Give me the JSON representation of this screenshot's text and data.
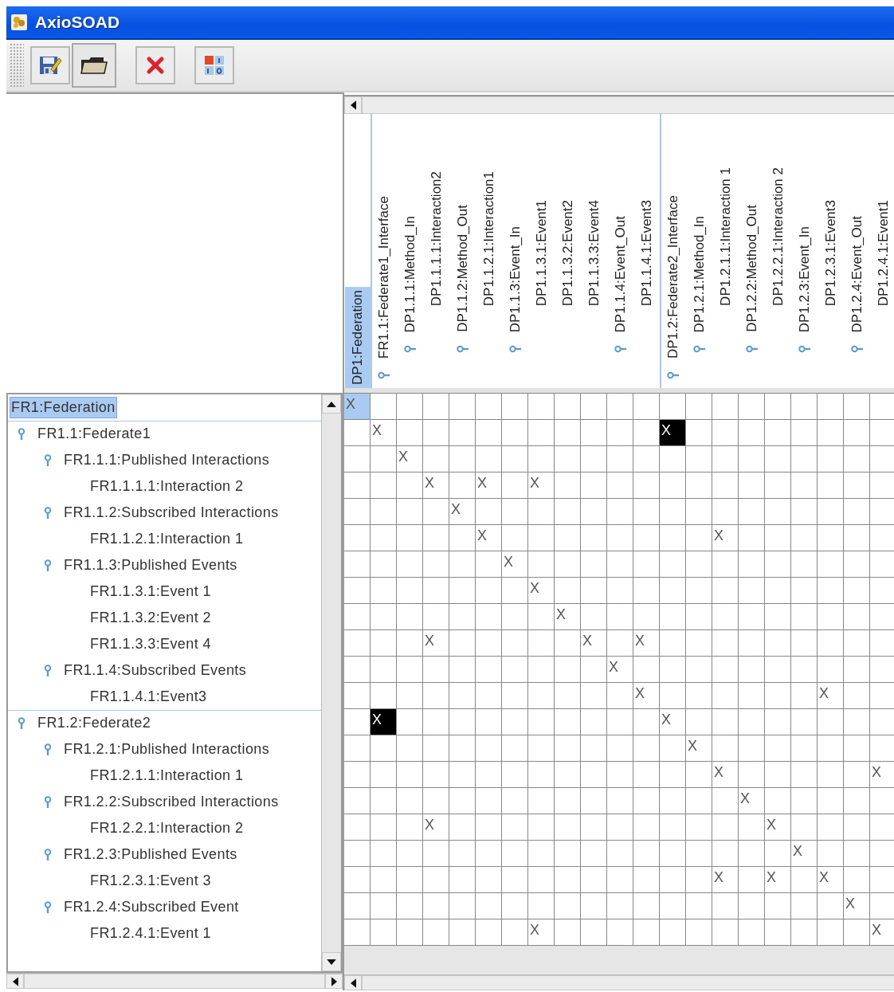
{
  "window": {
    "title": "AxioSOAD"
  },
  "toolbar": {
    "buttons": [
      {
        "kind": "edit",
        "pressed": false
      },
      {
        "kind": "open",
        "pressed": true
      },
      {
        "kind": "delete",
        "pressed": false
      },
      {
        "kind": "matrix",
        "pressed": false
      }
    ]
  },
  "matrix": {
    "columns": [
      {
        "label": "DP1:Federation",
        "selected": true,
        "children": [
          {
            "label": "FR1.1:Federate1_Interface",
            "selected": false,
            "children": [
              {
                "label": "DP1.1.1:Method_In",
                "selected": false,
                "children": [
                  {
                    "label": "DP1.1.1.1:Interaction2",
                    "selected": false
                  }
                ]
              },
              {
                "label": "DP1.1.2:Method_Out",
                "selected": false,
                "children": [
                  {
                    "label": "DP1.1.2.1:Interaction1",
                    "selected": false
                  }
                ]
              },
              {
                "label": "DP1.1.3:Event_In",
                "selected": false,
                "children": [
                  {
                    "label": "DP1.1.3.1:Event1",
                    "selected": false
                  },
                  {
                    "label": "DP1.1.3.2:Event2",
                    "selected": false
                  },
                  {
                    "label": "DP1.1.3.3:Event4",
                    "selected": false
                  }
                ]
              },
              {
                "label": "DP1.1.4:Event_Out",
                "selected": false,
                "children": [
                  {
                    "label": "DP1.1.4.1:Event3",
                    "selected": false
                  }
                ]
              }
            ]
          },
          {
            "label": "DP1.2:Federate2_Interface",
            "selected": false,
            "children": [
              {
                "label": "DP1.2.1:Method_In",
                "selected": false,
                "children": [
                  {
                    "label": "DP1.2.1.1:Interaction 1",
                    "selected": false
                  }
                ]
              },
              {
                "label": "DP1.2.2:Method_Out",
                "selected": false,
                "children": [
                  {
                    "label": "DP1.2.2.1:Interaction 2",
                    "selected": false
                  }
                ]
              },
              {
                "label": "DP1.2.3:Event_In",
                "selected": false,
                "children": [
                  {
                    "label": "DP1.2.3.1:Event3",
                    "selected": false
                  }
                ]
              },
              {
                "label": "DP1.2.4:Event_Out",
                "selected": false,
                "children": [
                  {
                    "label": "DP1.2.4.1:Event1",
                    "selected": false
                  }
                ]
              }
            ]
          }
        ]
      }
    ],
    "rows": [
      {
        "label": "FR1:Federation",
        "selected": true,
        "cells": [
          {
            "kind": "selected",
            "text": "X"
          },
          {},
          {},
          {},
          {},
          {},
          {},
          {},
          {},
          {},
          {},
          {},
          {},
          {},
          {},
          {},
          {},
          {},
          {},
          {},
          {}
        ],
        "children": [
          {
            "label": "FR1.1:Federate1",
            "selected": false,
            "cells": [
              {},
              {
                "text": "X"
              },
              {},
              {},
              {},
              {},
              {},
              {},
              {},
              {},
              {},
              {},
              {
                "kind": "conflict",
                "text": "X"
              },
              {},
              {},
              {},
              {},
              {},
              {},
              {},
              {}
            ],
            "children": [
              {
                "label": "FR1.1.1:Published Interactions",
                "selected": false,
                "cells": [
                  {},
                  {},
                  {
                    "text": "X"
                  },
                  {},
                  {},
                  {},
                  {},
                  {},
                  {},
                  {},
                  {},
                  {},
                  {},
                  {},
                  {},
                  {},
                  {},
                  {},
                  {},
                  {},
                  {}
                ],
                "children": [
                  {
                    "label": "FR1.1.1.1:Interaction 2",
                    "selected": false,
                    "cells": [
                      {},
                      {},
                      {},
                      {
                        "text": "X"
                      },
                      {},
                      {
                        "text": "X"
                      },
                      {},
                      {
                        "text": "X"
                      },
                      {},
                      {},
                      {},
                      {},
                      {},
                      {},
                      {},
                      {},
                      {},
                      {},
                      {},
                      {},
                      {}
                    ]
                  }
                ]
              },
              {
                "label": "FR1.1.2:Subscribed Interactions",
                "selected": false,
                "cells": [
                  {},
                  {},
                  {},
                  {},
                  {
                    "text": "X"
                  },
                  {},
                  {},
                  {},
                  {},
                  {},
                  {},
                  {},
                  {},
                  {},
                  {},
                  {},
                  {},
                  {},
                  {},
                  {},
                  {}
                ],
                "children": [
                  {
                    "label": "FR1.1.2.1:Interaction 1",
                    "selected": false,
                    "cells": [
                      {},
                      {},
                      {},
                      {},
                      {},
                      {
                        "text": "X"
                      },
                      {},
                      {},
                      {},
                      {},
                      {},
                      {},
                      {},
                      {},
                      {
                        "text": "X"
                      },
                      {},
                      {},
                      {},
                      {},
                      {},
                      {}
                    ]
                  }
                ]
              },
              {
                "label": "FR1.1.3:Published Events",
                "selected": false,
                "cells": [
                  {},
                  {},
                  {},
                  {},
                  {},
                  {},
                  {
                    "text": "X"
                  },
                  {},
                  {},
                  {},
                  {},
                  {},
                  {},
                  {},
                  {},
                  {},
                  {},
                  {},
                  {},
                  {},
                  {}
                ],
                "children": [
                  {
                    "label": "FR1.1.3.1:Event 1",
                    "selected": false,
                    "cells": [
                      {},
                      {},
                      {},
                      {},
                      {},
                      {},
                      {},
                      {
                        "text": "X"
                      },
                      {},
                      {},
                      {},
                      {},
                      {},
                      {},
                      {},
                      {},
                      {},
                      {},
                      {},
                      {},
                      {}
                    ]
                  },
                  {
                    "label": "FR1.1.3.2:Event 2",
                    "selected": false,
                    "cells": [
                      {},
                      {},
                      {},
                      {},
                      {},
                      {},
                      {},
                      {},
                      {
                        "text": "X"
                      },
                      {},
                      {},
                      {},
                      {},
                      {},
                      {},
                      {},
                      {},
                      {},
                      {},
                      {},
                      {}
                    ]
                  },
                  {
                    "label": "FR1.1.3.3:Event 4",
                    "selected": false,
                    "cells": [
                      {},
                      {},
                      {},
                      {
                        "text": "X"
                      },
                      {},
                      {},
                      {},
                      {},
                      {},
                      {
                        "text": "X"
                      },
                      {},
                      {
                        "text": "X"
                      },
                      {},
                      {},
                      {},
                      {},
                      {},
                      {},
                      {},
                      {},
                      {}
                    ]
                  }
                ]
              },
              {
                "label": "FR1.1.4:Subscribed Events",
                "selected": false,
                "cells": [
                  {},
                  {},
                  {},
                  {},
                  {},
                  {},
                  {},
                  {},
                  {},
                  {},
                  {
                    "text": "X"
                  },
                  {},
                  {},
                  {},
                  {},
                  {},
                  {},
                  {},
                  {},
                  {},
                  {}
                ],
                "children": [
                  {
                    "label": "FR1.1.4.1:Event3",
                    "selected": false,
                    "cells": [
                      {},
                      {},
                      {},
                      {},
                      {},
                      {},
                      {},
                      {},
                      {},
                      {},
                      {},
                      {
                        "text": "X"
                      },
                      {},
                      {},
                      {},
                      {},
                      {},
                      {},
                      {
                        "text": "X"
                      },
                      {},
                      {}
                    ]
                  }
                ]
              }
            ]
          },
          {
            "label": "FR1.2:Federate2",
            "selected": false,
            "cells": [
              {},
              {
                "kind": "conflict",
                "text": "X"
              },
              {},
              {},
              {},
              {},
              {},
              {},
              {},
              {},
              {},
              {},
              {
                "text": "X"
              },
              {},
              {},
              {},
              {},
              {},
              {},
              {},
              {}
            ],
            "children": [
              {
                "label": "FR1.2.1:Published Interactions",
                "selected": false,
                "cells": [
                  {},
                  {},
                  {},
                  {},
                  {},
                  {},
                  {},
                  {},
                  {},
                  {},
                  {},
                  {},
                  {},
                  {
                    "text": "X"
                  },
                  {},
                  {},
                  {},
                  {},
                  {},
                  {},
                  {}
                ],
                "children": [
                  {
                    "label": "FR1.2.1.1:Interaction 1",
                    "selected": false,
                    "cells": [
                      {},
                      {},
                      {},
                      {},
                      {},
                      {},
                      {},
                      {},
                      {},
                      {},
                      {},
                      {},
                      {},
                      {},
                      {
                        "text": "X"
                      },
                      {},
                      {},
                      {},
                      {},
                      {},
                      {
                        "text": "X"
                      }
                    ]
                  }
                ]
              },
              {
                "label": "FR1.2.2:Subscribed Interactions",
                "selected": false,
                "cells": [
                  {},
                  {},
                  {},
                  {},
                  {},
                  {},
                  {},
                  {},
                  {},
                  {},
                  {},
                  {},
                  {},
                  {},
                  {},
                  {
                    "text": "X"
                  },
                  {},
                  {},
                  {},
                  {},
                  {}
                ],
                "children": [
                  {
                    "label": "FR1.2.2.1:Interaction 2",
                    "selected": false,
                    "cells": [
                      {},
                      {},
                      {},
                      {
                        "text": "X"
                      },
                      {},
                      {},
                      {},
                      {},
                      {},
                      {},
                      {},
                      {},
                      {},
                      {},
                      {},
                      {},
                      {
                        "text": "X"
                      },
                      {},
                      {},
                      {},
                      {}
                    ]
                  }
                ]
              },
              {
                "label": "FR1.2.3:Published Events",
                "selected": false,
                "cells": [
                  {},
                  {},
                  {},
                  {},
                  {},
                  {},
                  {},
                  {},
                  {},
                  {},
                  {},
                  {},
                  {},
                  {},
                  {},
                  {},
                  {},
                  {
                    "text": "X"
                  },
                  {},
                  {},
                  {}
                ],
                "children": [
                  {
                    "label": "FR1.2.3.1:Event 3",
                    "selected": false,
                    "cells": [
                      {},
                      {},
                      {},
                      {},
                      {},
                      {},
                      {},
                      {},
                      {},
                      {},
                      {},
                      {},
                      {},
                      {},
                      {
                        "text": "X"
                      },
                      {},
                      {
                        "text": "X"
                      },
                      {},
                      {
                        "text": "X"
                      },
                      {},
                      {}
                    ]
                  }
                ]
              },
              {
                "label": "FR1.2.4:Subscribed Event",
                "selected": false,
                "cells": [
                  {},
                  {},
                  {},
                  {},
                  {},
                  {},
                  {},
                  {},
                  {},
                  {},
                  {},
                  {},
                  {},
                  {},
                  {},
                  {},
                  {},
                  {},
                  {},
                  {
                    "text": "X"
                  },
                  {}
                ],
                "children": [
                  {
                    "label": "FR1.2.4.1:Event  1",
                    "selected": false,
                    "cells": [
                      {},
                      {},
                      {},
                      {},
                      {},
                      {},
                      {},
                      {
                        "text": "X"
                      },
                      {},
                      {},
                      {},
                      {},
                      {},
                      {},
                      {},
                      {},
                      {},
                      {},
                      {},
                      {},
                      {
                        "text": "X"
                      }
                    ]
                  }
                ]
              }
            ]
          }
        ]
      }
    ]
  }
}
